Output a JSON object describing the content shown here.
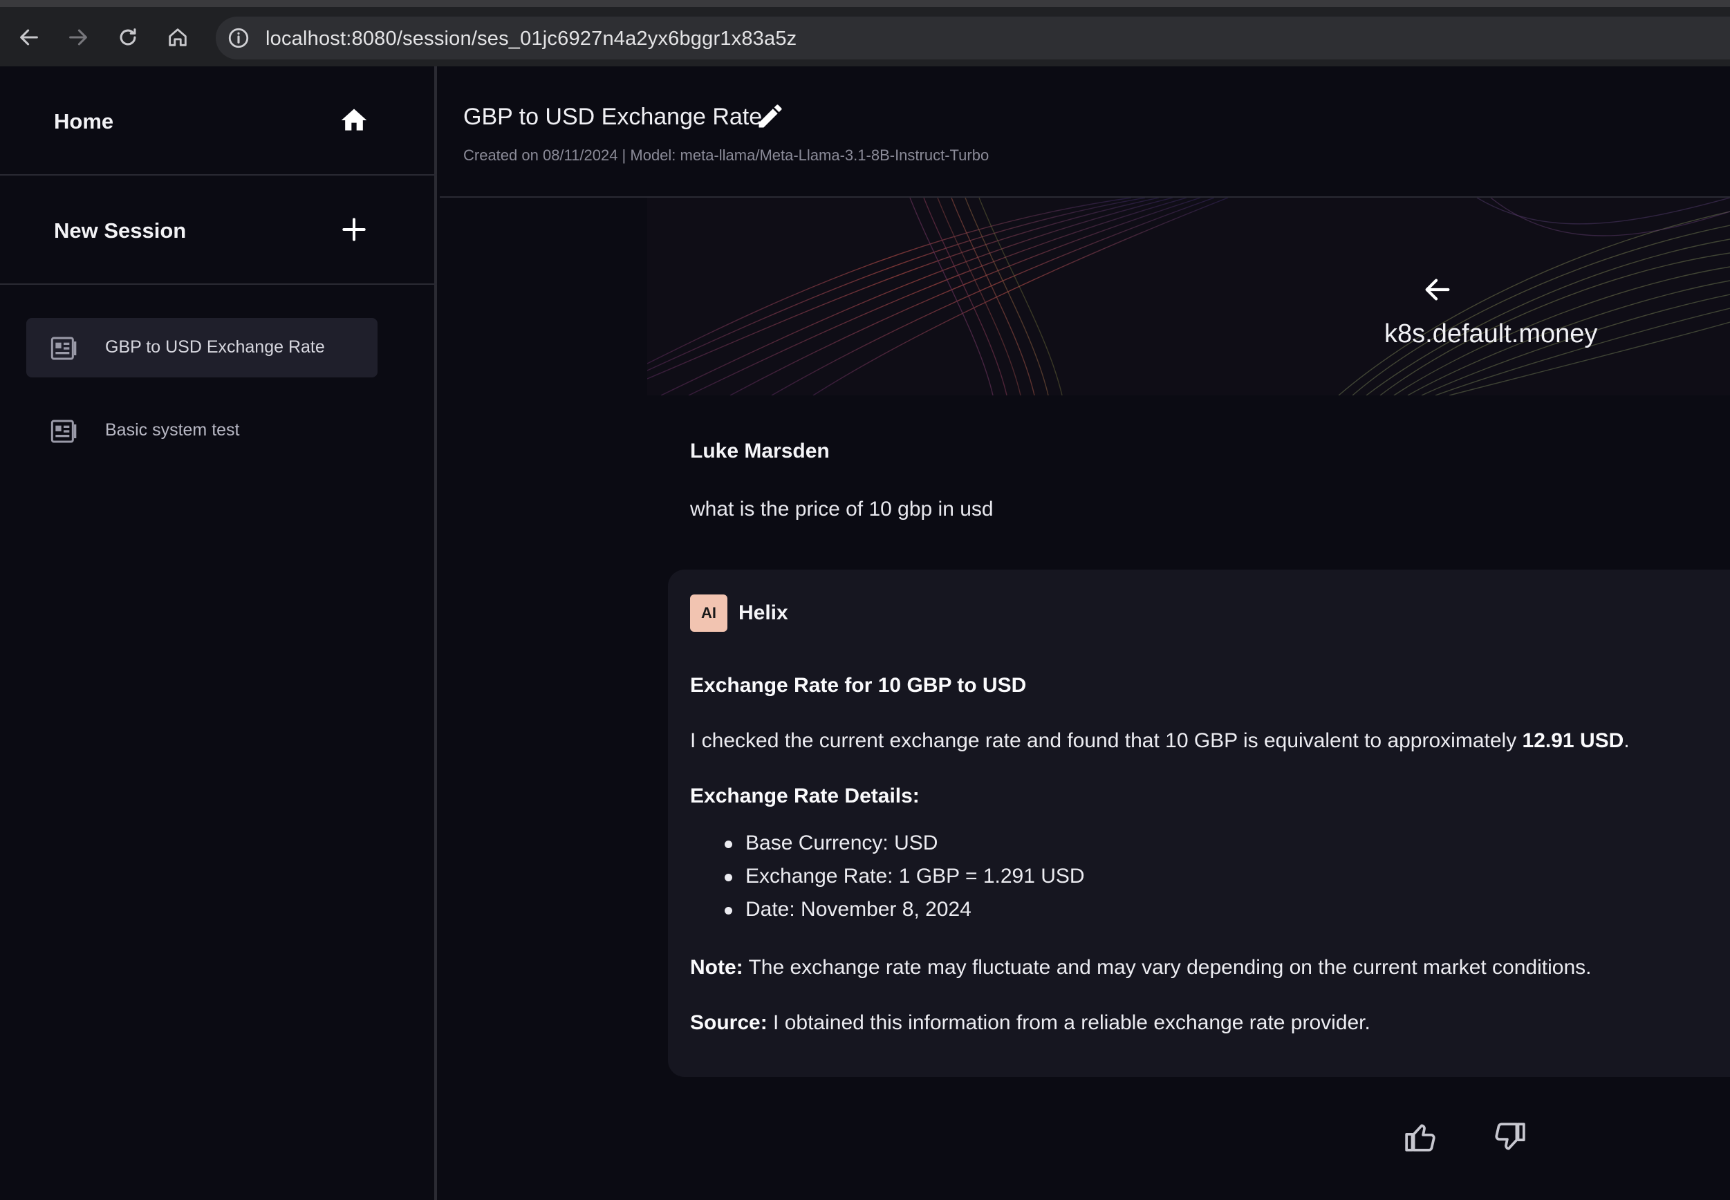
{
  "browser": {
    "url": "localhost:8080/session/ses_01jc6927n4a2yx6bggr1x83a5z"
  },
  "sidebar": {
    "home_label": "Home",
    "new_session_label": "New Session",
    "sessions": [
      {
        "label": "GBP to USD Exchange Rate",
        "active": true
      },
      {
        "label": "Basic system test",
        "active": false
      }
    ]
  },
  "session": {
    "title": "GBP to USD Exchange Rate",
    "meta": "Created on 08/11/2024 | Model: meta-llama/Meta-Llama-3.1-8B-Instruct-Turbo"
  },
  "banner": {
    "app_name": "k8s.default.money"
  },
  "user_message": {
    "author": "Luke Marsden",
    "text": "what is the price of 10 gbp in usd"
  },
  "assistant_message": {
    "avatar_text": "AI",
    "author": "Helix",
    "heading": "Exchange Rate for 10 GBP to USD",
    "intro": "I checked the current exchange rate and found that 10 GBP is equivalent to approximately ",
    "intro_value": "12.91 USD",
    "intro_end": ".",
    "details_heading": "Exchange Rate Details:",
    "details": [
      "Base Currency: USD",
      "Exchange Rate: 1 GBP = 1.291 USD",
      "Date: November 8, 2024"
    ],
    "note_label": "Note:",
    "note_text": " The exchange rate may fluctuate and may vary depending on the current market conditions.",
    "source_label": "Source:",
    "source_text": " I obtained this information from a reliable exchange rate provider."
  },
  "colors": {
    "background": "#0b0b13",
    "card": "#161620",
    "avatar": "#f2c4b1",
    "active_session": "#1f1f2b"
  }
}
